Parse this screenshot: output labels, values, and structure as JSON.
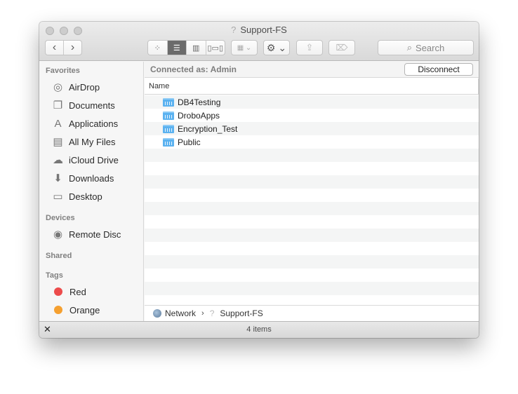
{
  "window": {
    "title": "Support-FS",
    "title_icon": "question-mark-icon"
  },
  "toolbar": {
    "back": "‹",
    "forward": "›",
    "views": [
      {
        "name": "icon-view",
        "glyph": "▫▫",
        "active": false
      },
      {
        "name": "list-view",
        "glyph": "☰",
        "active": true
      },
      {
        "name": "column-view",
        "glyph": "▥",
        "active": false
      },
      {
        "name": "cover-flow-view",
        "glyph": "|▭|",
        "active": false
      }
    ],
    "arrange_glyph": "▦ ⌄",
    "action_glyph": "⚙ ⌄",
    "share_glyph": "⇪",
    "tag_glyph": "⌦",
    "search_placeholder": "Search",
    "search_glyph": "⌕"
  },
  "sidebar": {
    "favorites_heading": "Favorites",
    "favorites": [
      {
        "label": "AirDrop",
        "icon": "airdrop-icon",
        "glyph": "◎"
      },
      {
        "label": "Documents",
        "icon": "documents-icon",
        "glyph": "❐"
      },
      {
        "label": "Applications",
        "icon": "applications-icon",
        "glyph": "A"
      },
      {
        "label": "All My Files",
        "icon": "all-my-files-icon",
        "glyph": "▤"
      },
      {
        "label": "iCloud Drive",
        "icon": "icloud-icon",
        "glyph": "☁"
      },
      {
        "label": "Downloads",
        "icon": "downloads-icon",
        "glyph": "⬇"
      },
      {
        "label": "Desktop",
        "icon": "desktop-icon",
        "glyph": "▭"
      }
    ],
    "devices_heading": "Devices",
    "devices": [
      {
        "label": "Remote Disc",
        "icon": "remote-disc-icon",
        "glyph": "◉"
      }
    ],
    "shared_heading": "Shared",
    "tags_heading": "Tags",
    "tags": [
      {
        "label": "Red",
        "color": "#ec4b4b"
      },
      {
        "label": "Orange",
        "color": "#f5a030"
      }
    ]
  },
  "content": {
    "connected_label": "Connected as: Admin",
    "disconnect_label": "Disconnect",
    "column_name": "Name",
    "files": [
      {
        "name": "DB4Testing"
      },
      {
        "name": "DroboApps"
      },
      {
        "name": "Encryption_Test"
      },
      {
        "name": "Public"
      }
    ]
  },
  "pathbar": {
    "items": [
      "Network",
      "Support-FS"
    ],
    "separator": "›",
    "qmark": "?"
  },
  "status": {
    "count": "4 items",
    "toggle_glyph": "✕"
  }
}
